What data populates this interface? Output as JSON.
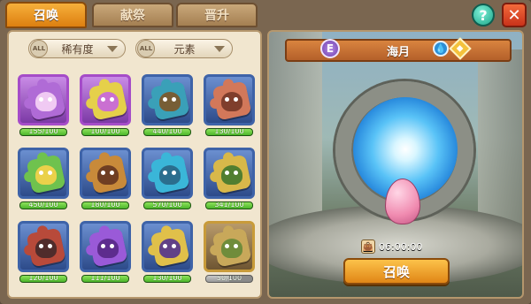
{
  "tabs": [
    {
      "label": "召唤",
      "active": true
    },
    {
      "label": "献祭",
      "active": false
    },
    {
      "label": "晋升",
      "active": false
    }
  ],
  "header": {
    "help_glyph": "?",
    "close_glyph": "✕"
  },
  "filters": [
    {
      "badge": "ALL",
      "label": "稀有度"
    },
    {
      "badge": "ALL",
      "label": "元素"
    }
  ],
  "fragments": [
    {
      "progress": "155/100",
      "current": 155,
      "required": 100,
      "frame": "purple",
      "color": "#b06bd6",
      "creature_color": "#f3d0f4"
    },
    {
      "progress": "100/100",
      "current": 100,
      "required": 100,
      "frame": "purple",
      "color": "#e5d04a",
      "creature_color": "#c86ad8"
    },
    {
      "progress": "440/100",
      "current": 440,
      "required": 100,
      "frame": "blue",
      "color": "#3aa0b8",
      "creature_color": "#7a5b2e"
    },
    {
      "progress": "130/100",
      "current": 130,
      "required": 100,
      "frame": "blue",
      "color": "#d2785a",
      "creature_color": "#7a3b2a"
    },
    {
      "progress": "450/100",
      "current": 450,
      "required": 100,
      "frame": "blue",
      "color": "#6fc24e",
      "creature_color": "#f0d24a"
    },
    {
      "progress": "180/100",
      "current": 180,
      "required": 100,
      "frame": "blue",
      "color": "#c88a3a",
      "creature_color": "#6a3a22"
    },
    {
      "progress": "570/100",
      "current": 570,
      "required": 100,
      "frame": "blue",
      "color": "#3ab6d8",
      "creature_color": "#2a6a8a"
    },
    {
      "progress": "341/100",
      "current": 341,
      "required": 100,
      "frame": "blue",
      "color": "#d8b84a",
      "creature_color": "#4a7a2e"
    },
    {
      "progress": "120/100",
      "current": 120,
      "required": 100,
      "frame": "blue",
      "color": "#b84a3a",
      "creature_color": "#4a2a2a"
    },
    {
      "progress": "111/100",
      "current": 111,
      "required": 100,
      "frame": "blue",
      "color": "#9a5ad8",
      "creature_color": "#5a2a8a"
    },
    {
      "progress": "130/100",
      "current": 130,
      "required": 100,
      "frame": "blue",
      "color": "#e0c04a",
      "creature_color": "#5a3a8a"
    },
    {
      "progress": "50/100",
      "current": 50,
      "required": 100,
      "frame": "gold",
      "color": "#c8a85a",
      "creature_color": "#6a8a3a"
    }
  ],
  "detail": {
    "rarity_badge": "E",
    "name": "海月",
    "element_icon": "water-drop-icon",
    "type_icon": "diamond-icon",
    "timer": "06:00:00",
    "summon_label": "召唤"
  },
  "colors": {
    "tab_active": "#f0a22a",
    "bar_full": "#4bb52a",
    "bar_incomplete": "#9a9a9a",
    "summon_button": "#f3a52f"
  }
}
